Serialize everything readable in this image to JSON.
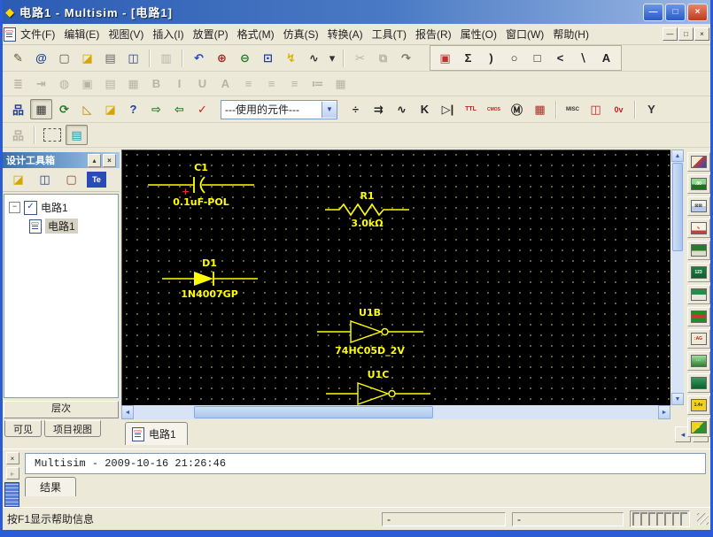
{
  "window": {
    "icon_glyph": "◆",
    "title": "电路1 - Multisim - [电路1]",
    "controls": {
      "minimize": "—",
      "maximize": "□",
      "close": "×"
    }
  },
  "menubar": {
    "items": [
      {
        "name": "menu-file",
        "label": "文件(F)"
      },
      {
        "name": "menu-edit",
        "label": "编辑(E)"
      },
      {
        "name": "menu-view",
        "label": "视图(V)"
      },
      {
        "name": "menu-insert",
        "label": "插入(I)"
      },
      {
        "name": "menu-place",
        "label": "放置(P)"
      },
      {
        "name": "menu-format",
        "label": "格式(M)"
      },
      {
        "name": "menu-simulate",
        "label": "仿真(S)"
      },
      {
        "name": "menu-transfer",
        "label": "转换(A)"
      },
      {
        "name": "menu-tools",
        "label": "工具(T)"
      },
      {
        "name": "menu-reports",
        "label": "报告(R)"
      },
      {
        "name": "menu-options",
        "label": "属性(O)"
      },
      {
        "name": "menu-window",
        "label": "窗口(W)"
      },
      {
        "name": "menu-help",
        "label": "帮助(H)"
      }
    ],
    "mdi_controls": {
      "minimize": "—",
      "restore": "□",
      "close": "×"
    }
  },
  "toolbars": {
    "standard": [
      {
        "name": "sketch-icon",
        "glyph": "✎",
        "color": "#555533"
      },
      {
        "name": "browse-database-icon",
        "glyph": "@",
        "color": "#1a3f9e"
      },
      {
        "name": "new-icon",
        "glyph": "▢",
        "color": "#555555"
      },
      {
        "name": "open-icon",
        "glyph": "◪",
        "color": "#d8a400"
      },
      {
        "name": "print-icon",
        "glyph": "▤",
        "color": "#666666"
      },
      {
        "name": "save-icon",
        "glyph": "◫",
        "color": "#27408b"
      },
      {
        "sep": true
      },
      {
        "name": "paste-icon",
        "glyph": "▥",
        "disabled": true
      },
      {
        "sep": true
      },
      {
        "name": "undo-icon",
        "glyph": "↶",
        "color": "#2a44bb"
      },
      {
        "name": "zoom-in-icon",
        "glyph": "⊕",
        "color": "#aa2222"
      },
      {
        "name": "zoom-out-icon",
        "glyph": "⊖",
        "color": "#227722"
      },
      {
        "name": "zoom-area-icon",
        "glyph": "⊡",
        "color": "#1a3f9e"
      },
      {
        "name": "run-simulation-icon",
        "glyph": "↯",
        "color": "#d8b400"
      },
      {
        "name": "grapher-icon",
        "glyph": "∿",
        "color": "#333333"
      },
      {
        "name": "grapher-dropdown-icon",
        "glyph": "▾",
        "color": "#333333",
        "cls": "narrow"
      },
      {
        "sep": true
      },
      {
        "name": "cut-icon",
        "glyph": "✂",
        "disabled": true
      },
      {
        "name": "copy-icon",
        "glyph": "⧉",
        "disabled": true
      },
      {
        "name": "redo-icon",
        "glyph": "↷",
        "color": "#777766"
      }
    ],
    "graphics": [
      {
        "name": "picture-icon",
        "glyph": "▣",
        "color": "#bb3333"
      },
      {
        "name": "polygon-icon",
        "glyph": "Σ",
        "color": "#222222"
      },
      {
        "name": "arc-icon",
        "glyph": ")",
        "color": "#222222"
      },
      {
        "name": "ellipse-icon",
        "glyph": "○",
        "color": "#222222"
      },
      {
        "name": "rectangle-icon",
        "glyph": "□",
        "color": "#222222"
      },
      {
        "name": "polyline-icon",
        "glyph": "<",
        "color": "#222222"
      },
      {
        "name": "line-icon",
        "glyph": "∖",
        "color": "#222222"
      },
      {
        "name": "text-icon",
        "glyph": "A",
        "color": "#222222"
      }
    ],
    "format": [
      {
        "name": "paragraph-icon",
        "glyph": "≣",
        "disabled": true
      },
      {
        "name": "tab-icon",
        "glyph": "⇥",
        "disabled": true
      },
      {
        "name": "palette-icon",
        "glyph": "◍",
        "disabled": true
      },
      {
        "name": "image-icon",
        "glyph": "▣",
        "disabled": true
      },
      {
        "name": "page-icon",
        "glyph": "▤",
        "disabled": true
      },
      {
        "name": "frame-icon",
        "glyph": "▦",
        "disabled": true
      },
      {
        "name": "bold-icon",
        "glyph": "B",
        "disabled": true
      },
      {
        "name": "italic-icon",
        "glyph": "I",
        "disabled": true
      },
      {
        "name": "underline-icon",
        "glyph": "U",
        "disabled": true
      },
      {
        "name": "font-color-icon",
        "glyph": "A",
        "disabled": true
      },
      {
        "name": "align-left-icon",
        "glyph": "≡",
        "disabled": true
      },
      {
        "name": "align-center-icon",
        "glyph": "≡",
        "disabled": true
      },
      {
        "name": "align-right-icon",
        "glyph": "≡",
        "disabled": true
      },
      {
        "name": "list-icon",
        "glyph": "≔",
        "disabled": true
      },
      {
        "name": "table-icon",
        "glyph": "▦",
        "disabled": true
      }
    ],
    "system": [
      {
        "name": "hierarchy-icon",
        "glyph": "品",
        "color": "#27408b"
      },
      {
        "name": "grid-icon",
        "glyph": "▦",
        "color": "#333333",
        "pressed": true
      },
      {
        "name": "database-icon",
        "glyph": "⟳",
        "color": "#227722"
      },
      {
        "name": "ruler-icon",
        "glyph": "◺",
        "color": "#b8860b"
      },
      {
        "name": "open-project-icon",
        "glyph": "◪",
        "color": "#d8a400"
      },
      {
        "name": "help-icon",
        "glyph": "?",
        "color": "#1a3f9e"
      },
      {
        "name": "export-icon",
        "glyph": "⇨",
        "color": "#227722"
      },
      {
        "name": "import-icon",
        "glyph": "⇦",
        "color": "#227722"
      },
      {
        "name": "erc-check-icon",
        "glyph": "✓",
        "color": "#bb2222"
      }
    ],
    "in_use_combo": "---使用的元件---",
    "components": [
      {
        "name": "source-family-icon",
        "glyph": "÷",
        "color": "#222222"
      },
      {
        "name": "diode-family-icon",
        "glyph": "⇉",
        "color": "#222222"
      },
      {
        "name": "basic-family-icon",
        "glyph": "∿",
        "color": "#222222"
      },
      {
        "name": "transistor-family-icon",
        "glyph": "K",
        "color": "#222222"
      },
      {
        "name": "analog-family-icon",
        "glyph": "▷|",
        "color": "#222222"
      },
      {
        "name": "ttl-family-icon",
        "glyph": "TTL",
        "color": "#bb2222",
        "size": "7px"
      },
      {
        "name": "cmos-family-icon",
        "glyph": "CMOS",
        "color": "#bb2222",
        "size": "5px"
      },
      {
        "name": "mixed-family-icon",
        "glyph": "Ⓜ",
        "color": "#222222"
      },
      {
        "name": "indicator-family-icon",
        "glyph": "▦",
        "color": "#bb2222"
      },
      {
        "sep": true
      },
      {
        "name": "misc-family-icon",
        "glyph": "MISC",
        "color": "#333333",
        "size": "6px"
      },
      {
        "name": "peripheral-family-icon",
        "glyph": "◫",
        "color": "#bb2222"
      },
      {
        "name": "power-family-icon",
        "glyph": "0v",
        "color": "#bb2222",
        "size": "9px"
      },
      {
        "sep": true
      },
      {
        "name": "rf-family-icon",
        "glyph": "Y",
        "color": "#333333"
      }
    ],
    "project": [
      {
        "name": "hierarchy-view-icon",
        "glyph": "品",
        "disabled": true
      },
      {
        "sep": true
      },
      {
        "name": "selection-rect-icon",
        "glyph": "",
        "cls": "dashed"
      },
      {
        "name": "report-view-icon",
        "glyph": "▤",
        "color": "#1a9ab0",
        "pressed": true
      }
    ]
  },
  "design_toolbox": {
    "title": "设计工具箱",
    "tools": [
      {
        "name": "open-sheet-icon",
        "glyph": "◪",
        "color": "#d8a400"
      },
      {
        "name": "save-sheet-icon",
        "glyph": "◫",
        "color": "#27408b"
      },
      {
        "name": "new-sheet-icon",
        "glyph": "▢",
        "color": "#884422"
      },
      {
        "name": "text-edit-icon",
        "glyph": "Te",
        "cls": "te"
      }
    ],
    "tree": {
      "root": "电路1",
      "child": "电路1"
    },
    "hierarchy_button": "层次",
    "tabs": [
      "可见",
      "项目视图"
    ]
  },
  "canvas": {
    "components": [
      {
        "ref": "C1",
        "value": "0.1uF-POL",
        "type": "capacitor-polarized"
      },
      {
        "ref": "R1",
        "value": "3.0kΩ",
        "type": "resistor"
      },
      {
        "ref": "D1",
        "value": "1N4007GP",
        "type": "diode"
      },
      {
        "ref": "U1B",
        "value": "74HC05D_2V",
        "type": "inverter-gate"
      },
      {
        "ref": "U1C",
        "value": "",
        "type": "inverter-gate"
      }
    ],
    "colors": {
      "background": "#000000",
      "grid_dot": "#76763c",
      "symbol": "#ffff00",
      "polarity_plus": "#ff2020"
    }
  },
  "sheet_tabs": {
    "active": "电路1"
  },
  "instruments": [
    {
      "name": "multimeter-icon",
      "swatch": "linear-gradient(135deg,#f2ead2 45%,#c23a3a 45%,#2a4ab8)"
    },
    {
      "name": "function-generator-icon",
      "swatch": "linear-gradient(180deg,#8fd98f 55%,#1f6f1f 55%)",
      "glyph": ".00"
    },
    {
      "name": "wattmeter-icon",
      "swatch": "linear-gradient(180deg,#f4f4ee 50%,#b9c9e9 50%)",
      "color": "#334",
      "glyph": "⊠⊠"
    },
    {
      "name": "oscilloscope-icon",
      "swatch": "linear-gradient(180deg,#f6f2e4 70%,#c24040 70%)",
      "color": "#a22",
      "glyph": "∿"
    },
    {
      "name": "four-channel-scope-icon",
      "swatch": "linear-gradient(180deg,#2a7a2a 55%,#dcdccb 55%)"
    },
    {
      "name": "frequency-counter-icon",
      "swatch": "linear-gradient(180deg,#1f7f3f,#0f5f2f)",
      "glyph": "123"
    },
    {
      "name": "word-generator-icon",
      "swatch": "linear-gradient(180deg,#2a8a4a 50%,#e8e8e0 50%)"
    },
    {
      "name": "logic-analyzer-icon",
      "swatch": "linear-gradient(180deg,#1f8f1f 34%,#c23a3a 34% 67%,#1f8f1f 67%)"
    },
    {
      "name": "logic-converter-icon",
      "swatch": "#efe9d5",
      "color": "#bb2222",
      "glyph": ":AG"
    },
    {
      "name": "distortion-analyzer-icon",
      "swatch": "linear-gradient(180deg,#9fdf9f,#2f7f2f)",
      "glyph": "···"
    },
    {
      "name": "spectrum-analyzer-icon",
      "swatch": "linear-gradient(180deg,#2f9f5f,#0f5f2f)"
    },
    {
      "name": "agilent-multimeter-icon",
      "swatch": "#f0d020",
      "color": "#333300",
      "glyph": "1.4v"
    },
    {
      "name": "agilent-oscilloscope-icon",
      "swatch": "linear-gradient(135deg,#f0d020 50%,#2f8f2f 50%)",
      "color": "#ffee00",
      "glyph": "▶"
    }
  ],
  "results_panel": {
    "text": "Multisim  -  2009-10-16 21:26:46",
    "tab": "结果"
  },
  "status_bar": {
    "help_text": "按F1显示帮助信息",
    "pane1": "-",
    "pane2": "-"
  },
  "theme": {
    "titlebar_left": "#2c5bb4",
    "titlebar_right": "#9cb8e4",
    "chrome": "#ece9d8",
    "window_border": "#2b5cd8",
    "panel_header_left": "#3a6ea5",
    "panel_header_right": "#a6caf0"
  }
}
